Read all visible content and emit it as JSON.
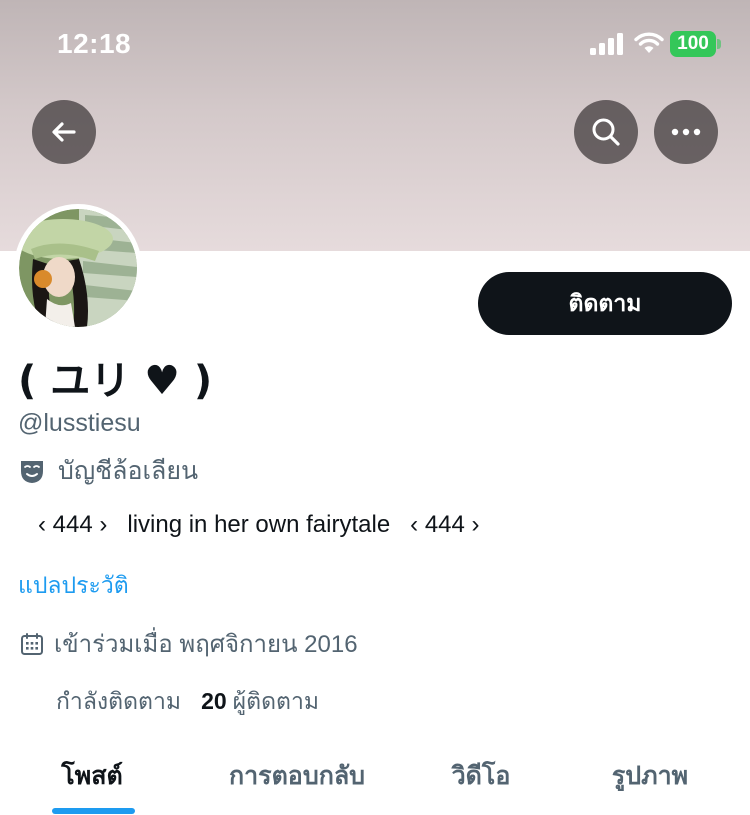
{
  "status_bar": {
    "time": "12:18",
    "battery": "100"
  },
  "profile": {
    "display_name": "( ユリ ♥ )",
    "handle": "@lusstiesu",
    "parody_label": "บัญชีล้อเลียน",
    "bio": "‹ 444 ›   living in her own fairytale   ‹ 444 ›",
    "translate_label": "แปลประวัติ",
    "joined": "เข้าร่วมเมื่อ พฤศจิกายน 2016",
    "following_label": "กำลังติดตาม",
    "followers_count": "20",
    "followers_label": "ผู้ติดตาม"
  },
  "actions": {
    "follow_label": "ติดตาม"
  },
  "tabs": [
    {
      "label": "โพสต์",
      "active": true
    },
    {
      "label": "การตอบกลับ",
      "active": false
    },
    {
      "label": "วิดีโอ",
      "active": false
    },
    {
      "label": "รูปภาพ",
      "active": false
    }
  ],
  "colors": {
    "accent": "#1d9bf0",
    "text_primary": "#0f1419",
    "text_secondary": "#536471",
    "battery": "#34c759"
  },
  "icons": [
    "back-arrow-icon",
    "search-icon",
    "more-icon",
    "parody-mask-icon",
    "calendar-icon",
    "signal-icon",
    "wifi-icon"
  ]
}
